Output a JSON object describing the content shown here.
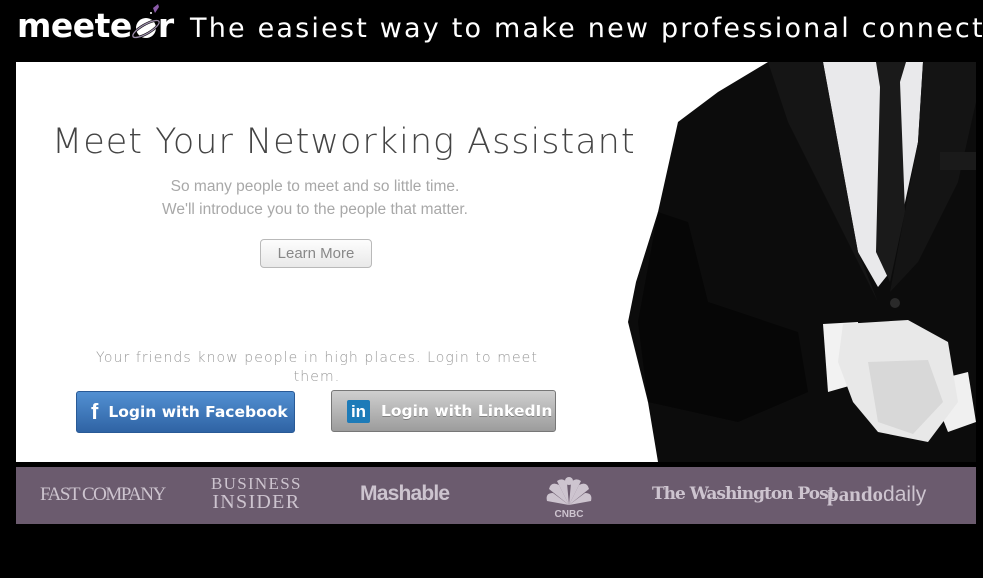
{
  "header": {
    "logo_text_start": "meete",
    "logo_text_end": "r",
    "logo_alt": "meeteor",
    "tagline": "The easiest way to make new professional connections"
  },
  "hero": {
    "title": "Meet Your Networking Assistant",
    "subtitle_line1": "So many people to meet and so little time.",
    "subtitle_line2": "We'll introduce you to the people that matter.",
    "learn_more_label": "Learn More",
    "friends_text": "Your friends know people in high places. Login to meet them.",
    "facebook_button": {
      "icon": "f",
      "label": "Login with Facebook",
      "color": "#3b6fb3"
    },
    "linkedin_button": {
      "icon": "in",
      "label": "Login with LinkedIn",
      "color": "#1d7bb8"
    }
  },
  "press": {
    "background": "#6b5b6e",
    "logos": [
      {
        "name": "Fast Company",
        "text": "FAST COMPANY"
      },
      {
        "name": "Business Insider",
        "line1": "BUSINESS",
        "line2": "INSIDER"
      },
      {
        "name": "Mashable",
        "text": "Mashable"
      },
      {
        "name": "CNBC",
        "text": "CNBC"
      },
      {
        "name": "The Washington Post",
        "text": "The Washington Post"
      },
      {
        "name": "PandoDaily",
        "bold": "pando",
        "light": "daily"
      }
    ]
  }
}
